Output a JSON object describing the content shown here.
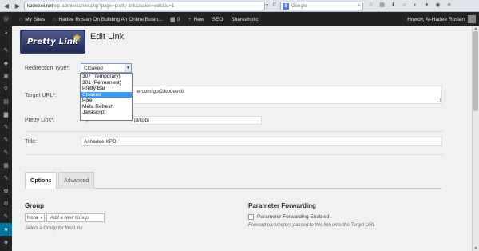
{
  "browser": {
    "url_domain": "kodeexii.net",
    "url_path": "/wp-admin/admin.php?page=pretty-link&action=edit&id=1",
    "search_placeholder": "Google",
    "search_engine_letter": "8"
  },
  "adminbar": {
    "my_sites": "My Sites",
    "site_name": "Hadee Roslan On Building An Online Busin...",
    "comments_count": "0",
    "new_label": "New",
    "seo_label": "SEO",
    "shareaholic_label": "Shareaholic",
    "howdy": "Howdy, Al-Hadee Roslan"
  },
  "logo": {
    "text": "Pretty Link",
    "star_icon": "star-icon"
  },
  "page": {
    "title": "Edit Link"
  },
  "form": {
    "redirection_label": "Redirection Type*:",
    "redirection_value": "Cloaked",
    "redirection_options": [
      "307 (Temporary)",
      "301 (Permanent)",
      "Pretty Bar",
      "Cloaked",
      "Pixel",
      "Meta Refresh",
      "Javascript"
    ],
    "target_label": "Target URL*:",
    "target_value": "e.com/go/2/kodeexii",
    "pretty_label": "Pretty Link*:",
    "pretty_prefix": "http://kodeexii.net/",
    "pretty_slug": "pl/kpbi",
    "title_label": "Title:",
    "title_value": "Ashadee KPBI"
  },
  "tabs": [
    {
      "label": "Options",
      "active": true
    },
    {
      "label": "Advanced",
      "active": false
    }
  ],
  "group": {
    "heading": "Group",
    "select_value": "None",
    "add_placeholder": "Add a New Group",
    "hint": "Select a Group for this Link"
  },
  "param": {
    "heading": "Parameter Forwarding",
    "checkbox_label": "Parameter Forwarding Enabled",
    "hint": "Forward parameters passed to this link onto the Target URL"
  },
  "colors": {
    "adminbar": "#222222",
    "menu_active": "#0074a2",
    "selection": "#3399ff"
  }
}
